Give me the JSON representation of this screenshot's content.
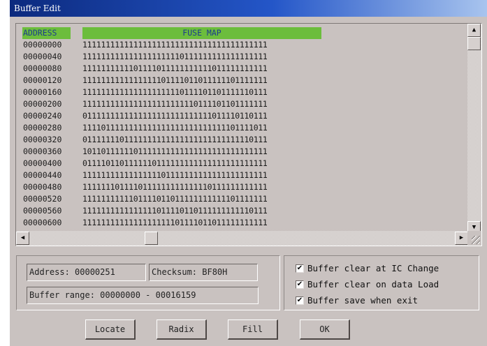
{
  "window": {
    "title": "Buffer Edit"
  },
  "fuse_map": {
    "col_address": "ADDRESS",
    "col_fuse": "FUSE MAP",
    "rows": [
      {
        "address": "00000000",
        "bits": "1111111111111111111111111111111111111111"
      },
      {
        "address": "00000040",
        "bits": "1111111111111111111110111111111111111111"
      },
      {
        "address": "00000080",
        "bits": "1111111111101111011111111111011111111111"
      },
      {
        "address": "00000120",
        "bits": "1111111111111111101111011011111101111111"
      },
      {
        "address": "00000160",
        "bits": "1111111111111111111110111101101111110111"
      },
      {
        "address": "00000200",
        "bits": "1111111111111111111111110111101101111111"
      },
      {
        "address": "00000240",
        "bits": "0111111111111111111111111111011110110111"
      },
      {
        "address": "00000280",
        "bits": "1111011111111111111111111111111101111011"
      },
      {
        "address": "00000320",
        "bits": "0111111101111111111111111111111111110111"
      },
      {
        "address": "00000360",
        "bits": "1011011111101111111111111111111111111111"
      },
      {
        "address": "00000400",
        "bits": "0111101101111110111111111111111111111111"
      },
      {
        "address": "00000440",
        "bits": "1111111111111111101111111111111111111111"
      },
      {
        "address": "00000480",
        "bits": "1111111011110111111111111110111111111111"
      },
      {
        "address": "00000520",
        "bits": "1111111111101111011011111111111101111111"
      },
      {
        "address": "00000560",
        "bits": "1111111111111111011110110111111111110111"
      },
      {
        "address": "00000600",
        "bits": "1111111111111111111101111011011111111111"
      }
    ]
  },
  "status": {
    "address": "Address: 00000251",
    "checksum": "Checksum: BF80H",
    "range": "Buffer range: 00000000 - 00016159"
  },
  "options": [
    {
      "label": "Buffer clear at IC Change",
      "checked": true
    },
    {
      "label": "Buffer clear on data Load",
      "checked": true
    },
    {
      "label": "Buffer save when exit",
      "checked": true
    }
  ],
  "buttons": {
    "locate": "Locate",
    "radix": "Radix",
    "fill": "Fill",
    "ok": "OK"
  },
  "scroll": {
    "vertical_position": 0.0,
    "horizontal_position": 0.28
  },
  "colors": {
    "header_bg": "#6cbd3c",
    "header_text": "#1c3c8c",
    "window_bg": "#c9c2c0",
    "titlebar": "#0c2a7e"
  },
  "icons": {
    "scroll_up": "arrow-up-icon",
    "scroll_down": "arrow-down-icon",
    "scroll_left": "arrow-left-icon",
    "scroll_right": "arrow-right-icon",
    "resize": "resize-grip-icon",
    "check": "checkmark-icon"
  }
}
